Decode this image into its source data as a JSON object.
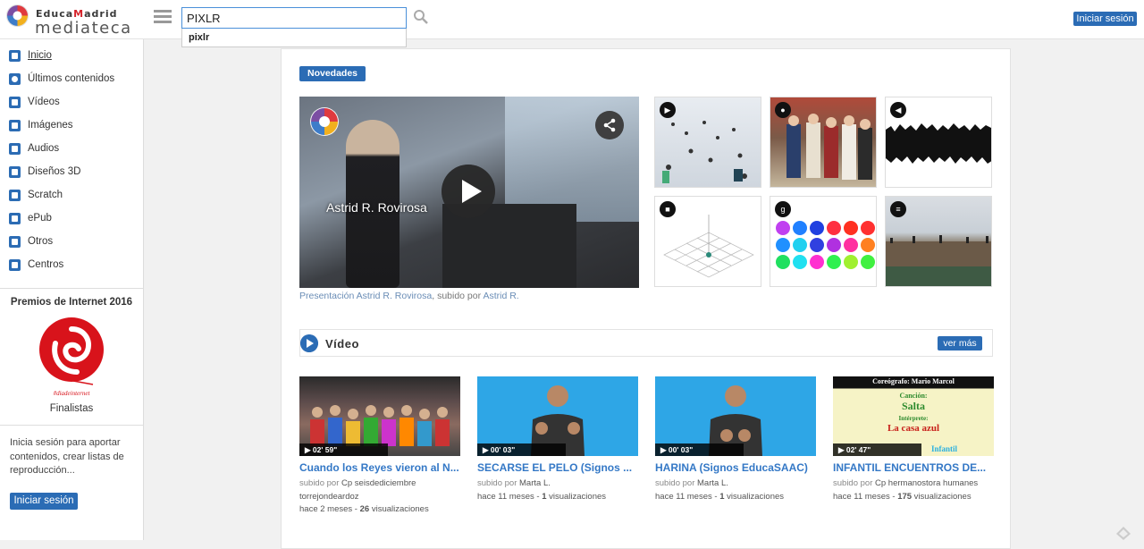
{
  "header": {
    "logo_top": "EducaMadrid",
    "logo_bottom": "mediateca",
    "search_value": "PIXLR",
    "search_suggestion": "pixlr",
    "login_label": "Iniciar sesión"
  },
  "sidebar": {
    "items": [
      {
        "label": "Inicio",
        "icon": "home-icon"
      },
      {
        "label": "Últimos contenidos",
        "icon": "clock-icon"
      },
      {
        "label": "Vídeos",
        "icon": "video-icon"
      },
      {
        "label": "Imágenes",
        "icon": "camera-icon"
      },
      {
        "label": "Audios",
        "icon": "audio-icon"
      },
      {
        "label": "Diseños 3D",
        "icon": "cube-icon"
      },
      {
        "label": "Scratch",
        "icon": "scratch-icon"
      },
      {
        "label": "ePub",
        "icon": "epub-icon"
      },
      {
        "label": "Otros",
        "icon": "document-icon"
      },
      {
        "label": "Centros",
        "icon": "folder-icon"
      }
    ],
    "premios_title": "Premios de Internet 2016",
    "premios_logo_text": "#diadeinternet",
    "finalistas": "Finalistas",
    "promo_text": "Inicia sesión para aportar contenidos, crear listas de reproducción...",
    "login_label": "Iniciar sesión"
  },
  "main": {
    "novedades_label": "Novedades",
    "hero": {
      "overlay_name": "Astrid R. Rovirosa",
      "caption_link": "Presentación Astrid R. Rovirosa",
      "caption_middle": ", subido por ",
      "caption_author": "Astrid R."
    },
    "section": {
      "title": "Vídeo",
      "ver_mas": "ver más"
    },
    "videos": [
      {
        "duration": "02' 59\"",
        "title": "Cuando los Reyes vieron al N...",
        "by_label": "subido por",
        "author": "Cp seisdediciembre torrejondeardoz",
        "age": "hace 2 meses",
        "sep": " - ",
        "views": "26",
        "views_label": " visualizaciones"
      },
      {
        "duration": "00' 03\"",
        "title": "SECARSE EL PELO (Signos ...",
        "by_label": "subido por",
        "author": "Marta L.",
        "age": "hace 11 meses",
        "sep": " - ",
        "views": "1",
        "views_label": " visualizaciones"
      },
      {
        "duration": "00' 03\"",
        "title": "HARINA (Signos EducaSAAC)",
        "by_label": "subido por",
        "author": "Marta L.",
        "age": "hace 11 meses",
        "sep": " - ",
        "views": "1",
        "views_label": " visualizaciones"
      },
      {
        "duration": "02' 47\"",
        "title": "INFANTIL ENCUENTROS DE...",
        "by_label": "subido por",
        "author": "Cp hermanostora humanes",
        "age": "hace 11 meses",
        "sep": " - ",
        "views": "175",
        "views_label": " visualizaciones"
      }
    ],
    "infantil_thumb": {
      "line1": "Coreógrafo: Mario Marcol",
      "line2": "Canción:",
      "line3": "Salta",
      "line4": "Intérprete:",
      "line5": "La casa azul",
      "line6": "Infantil"
    }
  },
  "colors": {
    "accent": "#2b6cb5",
    "link": "#3478c6"
  }
}
